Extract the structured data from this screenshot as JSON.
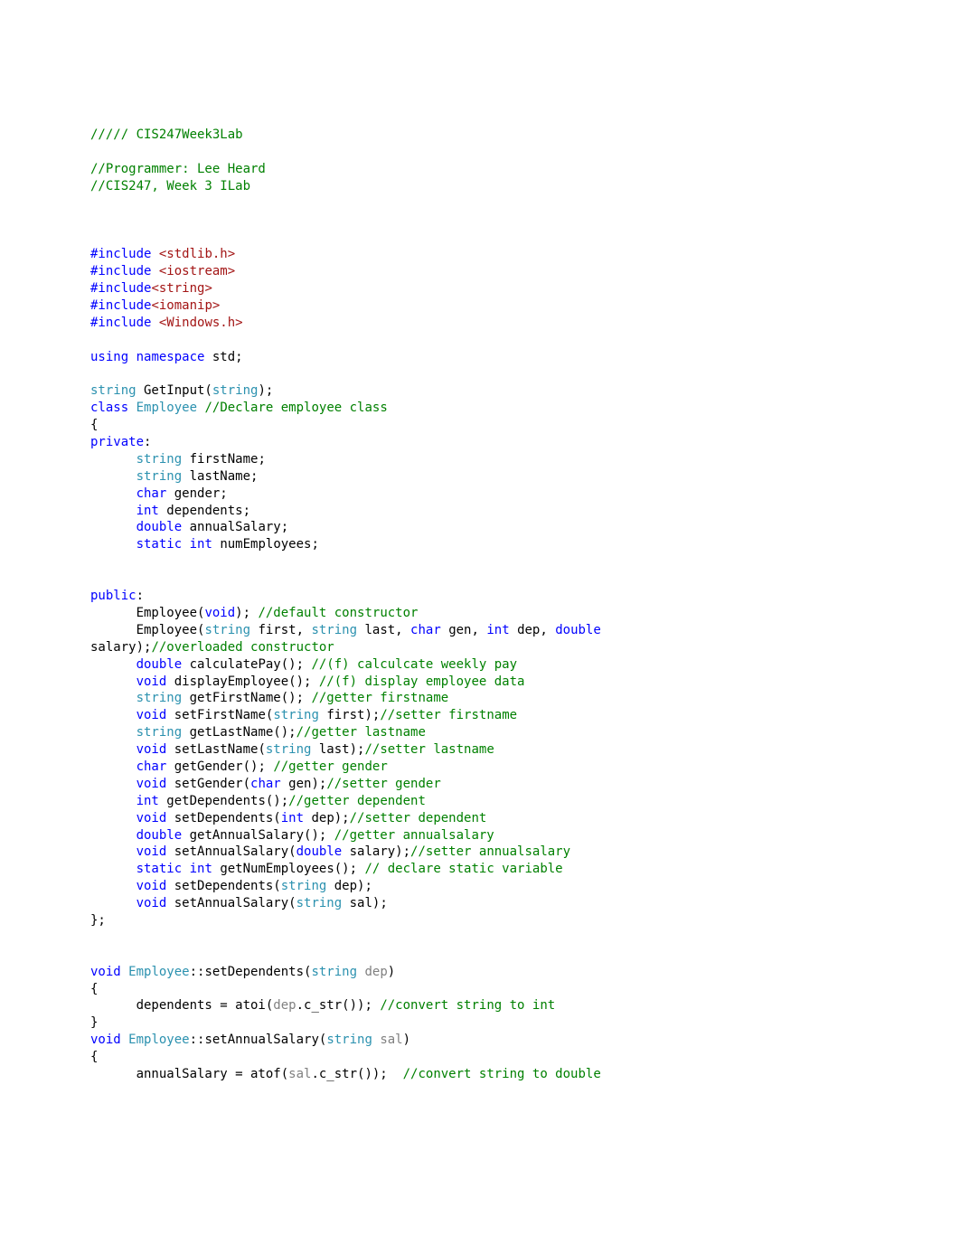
{
  "lines": [
    [
      [
        "green",
        "///// CIS247Week3Lab"
      ]
    ],
    [
      [
        "black",
        ""
      ]
    ],
    [
      [
        "green",
        "//Programmer: Lee Heard"
      ]
    ],
    [
      [
        "green",
        "//CIS247, Week 3 ILab"
      ]
    ],
    [
      [
        "black",
        ""
      ]
    ],
    [
      [
        "black",
        ""
      ]
    ],
    [
      [
        "black",
        ""
      ]
    ],
    [
      [
        "blue",
        "#include"
      ],
      [
        "black",
        " "
      ],
      [
        "red",
        "<stdlib.h>"
      ]
    ],
    [
      [
        "blue",
        "#include"
      ],
      [
        "black",
        " "
      ],
      [
        "red",
        "<iostream>"
      ]
    ],
    [
      [
        "blue",
        "#include"
      ],
      [
        "red",
        "<string>"
      ]
    ],
    [
      [
        "blue",
        "#include"
      ],
      [
        "red",
        "<iomanip>"
      ]
    ],
    [
      [
        "blue",
        "#include"
      ],
      [
        "black",
        " "
      ],
      [
        "red",
        "<Windows.h>"
      ]
    ],
    [
      [
        "black",
        ""
      ]
    ],
    [
      [
        "blue",
        "using"
      ],
      [
        "black",
        " "
      ],
      [
        "blue",
        "namespace"
      ],
      [
        "black",
        " std;"
      ]
    ],
    [
      [
        "black",
        ""
      ]
    ],
    [
      [
        "teal",
        "string"
      ],
      [
        "black",
        " GetInput("
      ],
      [
        "teal",
        "string"
      ],
      [
        "black",
        ");"
      ]
    ],
    [
      [
        "blue",
        "class"
      ],
      [
        "black",
        " "
      ],
      [
        "teal",
        "Employee"
      ],
      [
        "black",
        " "
      ],
      [
        "green",
        "//Declare employee class"
      ]
    ],
    [
      [
        "black",
        "{"
      ]
    ],
    [
      [
        "blue",
        "private"
      ],
      [
        "black",
        ":"
      ]
    ],
    [
      [
        "black",
        "      "
      ],
      [
        "teal",
        "string"
      ],
      [
        "black",
        " firstName;"
      ]
    ],
    [
      [
        "black",
        "      "
      ],
      [
        "teal",
        "string"
      ],
      [
        "black",
        " lastName;"
      ]
    ],
    [
      [
        "black",
        "      "
      ],
      [
        "blue",
        "char"
      ],
      [
        "black",
        " gender;"
      ]
    ],
    [
      [
        "black",
        "      "
      ],
      [
        "blue",
        "int"
      ],
      [
        "black",
        " dependents;"
      ]
    ],
    [
      [
        "black",
        "      "
      ],
      [
        "blue",
        "double"
      ],
      [
        "black",
        " annualSalary;"
      ]
    ],
    [
      [
        "black",
        "      "
      ],
      [
        "blue",
        "static"
      ],
      [
        "black",
        " "
      ],
      [
        "blue",
        "int"
      ],
      [
        "black",
        " numEmployees;"
      ]
    ],
    [
      [
        "black",
        ""
      ]
    ],
    [
      [
        "black",
        ""
      ]
    ],
    [
      [
        "blue",
        "public"
      ],
      [
        "black",
        ":"
      ]
    ],
    [
      [
        "black",
        "      Employee("
      ],
      [
        "blue",
        "void"
      ],
      [
        "black",
        "); "
      ],
      [
        "green",
        "//default constructor"
      ]
    ],
    [
      [
        "black",
        "      Employee("
      ],
      [
        "teal",
        "string"
      ],
      [
        "black",
        " first, "
      ],
      [
        "teal",
        "string"
      ],
      [
        "black",
        " last, "
      ],
      [
        "blue",
        "char"
      ],
      [
        "black",
        " gen, "
      ],
      [
        "blue",
        "int"
      ],
      [
        "black",
        " dep, "
      ],
      [
        "blue",
        "double"
      ],
      [
        "black",
        " "
      ]
    ],
    [
      [
        "black",
        "salary);"
      ],
      [
        "green",
        "//overloaded constructor"
      ]
    ],
    [
      [
        "black",
        "      "
      ],
      [
        "blue",
        "double"
      ],
      [
        "black",
        " calculatePay(); "
      ],
      [
        "green",
        "//(f) calculcate weekly pay"
      ]
    ],
    [
      [
        "black",
        "      "
      ],
      [
        "blue",
        "void"
      ],
      [
        "black",
        " displayEmployee(); "
      ],
      [
        "green",
        "//(f) display employee data"
      ]
    ],
    [
      [
        "black",
        "      "
      ],
      [
        "teal",
        "string"
      ],
      [
        "black",
        " getFirstName(); "
      ],
      [
        "green",
        "//getter firstname"
      ]
    ],
    [
      [
        "black",
        "      "
      ],
      [
        "blue",
        "void"
      ],
      [
        "black",
        " setFirstName("
      ],
      [
        "teal",
        "string"
      ],
      [
        "black",
        " first);"
      ],
      [
        "green",
        "//setter firstname"
      ]
    ],
    [
      [
        "black",
        "      "
      ],
      [
        "teal",
        "string"
      ],
      [
        "black",
        " getLastName();"
      ],
      [
        "green",
        "//getter lastname"
      ]
    ],
    [
      [
        "black",
        "      "
      ],
      [
        "blue",
        "void"
      ],
      [
        "black",
        " setLastName("
      ],
      [
        "teal",
        "string"
      ],
      [
        "black",
        " last);"
      ],
      [
        "green",
        "//setter lastname"
      ]
    ],
    [
      [
        "black",
        "      "
      ],
      [
        "blue",
        "char"
      ],
      [
        "black",
        " getGender(); "
      ],
      [
        "green",
        "//getter gender"
      ]
    ],
    [
      [
        "black",
        "      "
      ],
      [
        "blue",
        "void"
      ],
      [
        "black",
        " setGender("
      ],
      [
        "blue",
        "char"
      ],
      [
        "black",
        " gen);"
      ],
      [
        "green",
        "//setter gender"
      ]
    ],
    [
      [
        "black",
        "      "
      ],
      [
        "blue",
        "int"
      ],
      [
        "black",
        " getDependents();"
      ],
      [
        "green",
        "//getter dependent"
      ]
    ],
    [
      [
        "black",
        "      "
      ],
      [
        "blue",
        "void"
      ],
      [
        "black",
        " setDependents("
      ],
      [
        "blue",
        "int"
      ],
      [
        "black",
        " dep);"
      ],
      [
        "green",
        "//setter dependent"
      ]
    ],
    [
      [
        "black",
        "      "
      ],
      [
        "blue",
        "double"
      ],
      [
        "black",
        " getAnnualSalary(); "
      ],
      [
        "green",
        "//getter annualsalary"
      ]
    ],
    [
      [
        "black",
        "      "
      ],
      [
        "blue",
        "void"
      ],
      [
        "black",
        " setAnnualSalary("
      ],
      [
        "blue",
        "double"
      ],
      [
        "black",
        " salary);"
      ],
      [
        "green",
        "//setter annualsalary"
      ]
    ],
    [
      [
        "black",
        "      "
      ],
      [
        "blue",
        "static"
      ],
      [
        "black",
        " "
      ],
      [
        "blue",
        "int"
      ],
      [
        "black",
        " getNumEmployees(); "
      ],
      [
        "green",
        "// declare static variable"
      ]
    ],
    [
      [
        "black",
        "      "
      ],
      [
        "blue",
        "void"
      ],
      [
        "black",
        " setDependents("
      ],
      [
        "teal",
        "string"
      ],
      [
        "black",
        " dep);"
      ]
    ],
    [
      [
        "black",
        "      "
      ],
      [
        "blue",
        "void"
      ],
      [
        "black",
        " setAnnualSalary("
      ],
      [
        "teal",
        "string"
      ],
      [
        "black",
        " sal);"
      ]
    ],
    [
      [
        "black",
        "};"
      ]
    ],
    [
      [
        "black",
        ""
      ]
    ],
    [
      [
        "black",
        ""
      ]
    ],
    [
      [
        "blue",
        "void"
      ],
      [
        "black",
        " "
      ],
      [
        "teal",
        "Employee"
      ],
      [
        "black",
        "::setDependents("
      ],
      [
        "teal",
        "string"
      ],
      [
        "black",
        " "
      ],
      [
        "gray",
        "dep"
      ],
      [
        "black",
        ")"
      ]
    ],
    [
      [
        "black",
        "{"
      ]
    ],
    [
      [
        "black",
        "      dependents = atoi("
      ],
      [
        "gray",
        "dep"
      ],
      [
        "black",
        ".c_str()); "
      ],
      [
        "green",
        "//convert string to int"
      ]
    ],
    [
      [
        "black",
        "}"
      ]
    ],
    [
      [
        "blue",
        "void"
      ],
      [
        "black",
        " "
      ],
      [
        "teal",
        "Employee"
      ],
      [
        "black",
        "::setAnnualSalary("
      ],
      [
        "teal",
        "string"
      ],
      [
        "black",
        " "
      ],
      [
        "gray",
        "sal"
      ],
      [
        "black",
        ")"
      ]
    ],
    [
      [
        "black",
        "{"
      ]
    ],
    [
      [
        "black",
        "      annualSalary = atof("
      ],
      [
        "gray",
        "sal"
      ],
      [
        "black",
        ".c_str());  "
      ],
      [
        "green",
        "//convert string to double"
      ]
    ]
  ]
}
